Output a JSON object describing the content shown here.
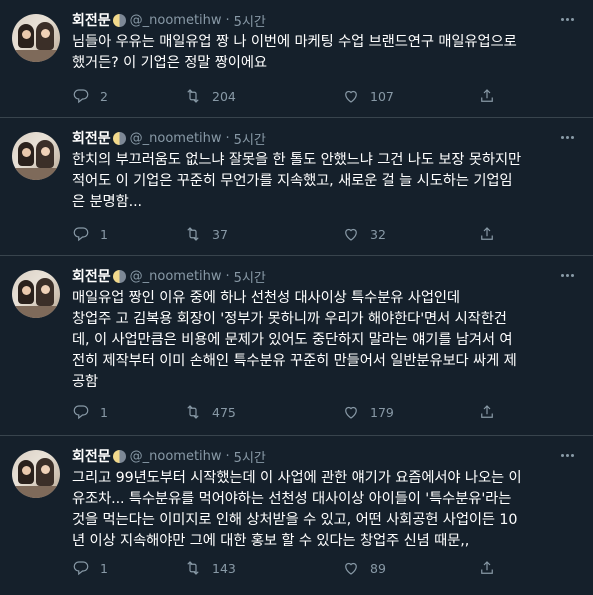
{
  "tweets": [
    {
      "name": "회전문",
      "handle": "@_noometihw",
      "time": "5시간",
      "lines": [
        "님들아 우유는 매일유업 짱 나 이번에 마케팅 수업 브랜드연구 매일유업으로",
        "했거든? 이 기업은 정말 짱이에요"
      ],
      "replies": "2",
      "retweets": "204",
      "likes": "107"
    },
    {
      "name": "회전문",
      "handle": "@_noometihw",
      "time": "5시간",
      "lines": [
        "한치의 부끄러움도 없느냐 잘못을 한 톨도 안했느냐 그건 나도 보장 못하지만",
        "적어도 이 기업은 꾸준히 무언가를 지속했고, 새로운 걸 늘 시도하는 기업임",
        "은 분명함..."
      ],
      "replies": "1",
      "retweets": "37",
      "likes": "32"
    },
    {
      "name": "회전문",
      "handle": "@_noometihw",
      "time": "5시간",
      "lines": [
        "매일유업 짱인 이유 중에 하나 선천성 대사이상 특수분유 사업인데",
        "창업주 고 김복용 회장이 '정부가 못하니까 우리가 해야한다'면서 시작한건",
        "데, 이 사업만큼은 비용에 문제가 있어도 중단하지 말라는 얘기를 남겨서 여",
        "전히 제작부터 이미 손해인 특수분유 꾸준히 만들어서 일반분유보다 싸게 제",
        "공함"
      ],
      "replies": "1",
      "retweets": "475",
      "likes": "179"
    },
    {
      "name": "회전문",
      "handle": "@_noometihw",
      "time": "5시간",
      "lines": [
        "그리고 99년도부터 시작했는데 이 사업에 관한 얘기가 요즘에서야 나오는 이",
        "유조차... 특수분유를 먹어야하는 선천성 대사이상 아이들이 '특수분유'라는",
        "것을 먹는다는 이미지로 인해 상처받을 수 있고, 어떤 사회공헌 사업이든 10",
        "년 이상 지속해야만 그에 대한 홍보 할 수 있다는 창업주 신념 때문,,"
      ],
      "replies": "1",
      "retweets": "143",
      "likes": "89"
    }
  ],
  "icons": {
    "reply": "reply-icon",
    "retweet": "retweet-icon",
    "like": "heart-icon",
    "share": "share-icon",
    "more": "more-icon",
    "badge": "moon-emoji-icon"
  },
  "colors": {
    "background": "#15202b",
    "divider": "#38444d",
    "secondary_text": "#8899a6",
    "primary_text": "#ffffff"
  }
}
